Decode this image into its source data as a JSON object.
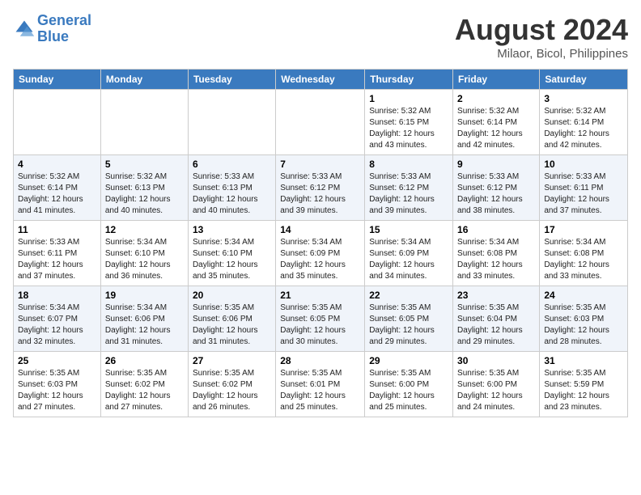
{
  "header": {
    "logo_line1": "General",
    "logo_line2": "Blue",
    "month_title": "August 2024",
    "subtitle": "Milaor, Bicol, Philippines"
  },
  "days_of_week": [
    "Sunday",
    "Monday",
    "Tuesday",
    "Wednesday",
    "Thursday",
    "Friday",
    "Saturday"
  ],
  "weeks": [
    [
      {
        "day": "",
        "info": ""
      },
      {
        "day": "",
        "info": ""
      },
      {
        "day": "",
        "info": ""
      },
      {
        "day": "",
        "info": ""
      },
      {
        "day": "1",
        "info": "Sunrise: 5:32 AM\nSunset: 6:15 PM\nDaylight: 12 hours and 43 minutes."
      },
      {
        "day": "2",
        "info": "Sunrise: 5:32 AM\nSunset: 6:14 PM\nDaylight: 12 hours and 42 minutes."
      },
      {
        "day": "3",
        "info": "Sunrise: 5:32 AM\nSunset: 6:14 PM\nDaylight: 12 hours and 42 minutes."
      }
    ],
    [
      {
        "day": "4",
        "info": "Sunrise: 5:32 AM\nSunset: 6:14 PM\nDaylight: 12 hours and 41 minutes."
      },
      {
        "day": "5",
        "info": "Sunrise: 5:32 AM\nSunset: 6:13 PM\nDaylight: 12 hours and 40 minutes."
      },
      {
        "day": "6",
        "info": "Sunrise: 5:33 AM\nSunset: 6:13 PM\nDaylight: 12 hours and 40 minutes."
      },
      {
        "day": "7",
        "info": "Sunrise: 5:33 AM\nSunset: 6:12 PM\nDaylight: 12 hours and 39 minutes."
      },
      {
        "day": "8",
        "info": "Sunrise: 5:33 AM\nSunset: 6:12 PM\nDaylight: 12 hours and 39 minutes."
      },
      {
        "day": "9",
        "info": "Sunrise: 5:33 AM\nSunset: 6:12 PM\nDaylight: 12 hours and 38 minutes."
      },
      {
        "day": "10",
        "info": "Sunrise: 5:33 AM\nSunset: 6:11 PM\nDaylight: 12 hours and 37 minutes."
      }
    ],
    [
      {
        "day": "11",
        "info": "Sunrise: 5:33 AM\nSunset: 6:11 PM\nDaylight: 12 hours and 37 minutes."
      },
      {
        "day": "12",
        "info": "Sunrise: 5:34 AM\nSunset: 6:10 PM\nDaylight: 12 hours and 36 minutes."
      },
      {
        "day": "13",
        "info": "Sunrise: 5:34 AM\nSunset: 6:10 PM\nDaylight: 12 hours and 35 minutes."
      },
      {
        "day": "14",
        "info": "Sunrise: 5:34 AM\nSunset: 6:09 PM\nDaylight: 12 hours and 35 minutes."
      },
      {
        "day": "15",
        "info": "Sunrise: 5:34 AM\nSunset: 6:09 PM\nDaylight: 12 hours and 34 minutes."
      },
      {
        "day": "16",
        "info": "Sunrise: 5:34 AM\nSunset: 6:08 PM\nDaylight: 12 hours and 33 minutes."
      },
      {
        "day": "17",
        "info": "Sunrise: 5:34 AM\nSunset: 6:08 PM\nDaylight: 12 hours and 33 minutes."
      }
    ],
    [
      {
        "day": "18",
        "info": "Sunrise: 5:34 AM\nSunset: 6:07 PM\nDaylight: 12 hours and 32 minutes."
      },
      {
        "day": "19",
        "info": "Sunrise: 5:34 AM\nSunset: 6:06 PM\nDaylight: 12 hours and 31 minutes."
      },
      {
        "day": "20",
        "info": "Sunrise: 5:35 AM\nSunset: 6:06 PM\nDaylight: 12 hours and 31 minutes."
      },
      {
        "day": "21",
        "info": "Sunrise: 5:35 AM\nSunset: 6:05 PM\nDaylight: 12 hours and 30 minutes."
      },
      {
        "day": "22",
        "info": "Sunrise: 5:35 AM\nSunset: 6:05 PM\nDaylight: 12 hours and 29 minutes."
      },
      {
        "day": "23",
        "info": "Sunrise: 5:35 AM\nSunset: 6:04 PM\nDaylight: 12 hours and 29 minutes."
      },
      {
        "day": "24",
        "info": "Sunrise: 5:35 AM\nSunset: 6:03 PM\nDaylight: 12 hours and 28 minutes."
      }
    ],
    [
      {
        "day": "25",
        "info": "Sunrise: 5:35 AM\nSunset: 6:03 PM\nDaylight: 12 hours and 27 minutes."
      },
      {
        "day": "26",
        "info": "Sunrise: 5:35 AM\nSunset: 6:02 PM\nDaylight: 12 hours and 27 minutes."
      },
      {
        "day": "27",
        "info": "Sunrise: 5:35 AM\nSunset: 6:02 PM\nDaylight: 12 hours and 26 minutes."
      },
      {
        "day": "28",
        "info": "Sunrise: 5:35 AM\nSunset: 6:01 PM\nDaylight: 12 hours and 25 minutes."
      },
      {
        "day": "29",
        "info": "Sunrise: 5:35 AM\nSunset: 6:00 PM\nDaylight: 12 hours and 25 minutes."
      },
      {
        "day": "30",
        "info": "Sunrise: 5:35 AM\nSunset: 6:00 PM\nDaylight: 12 hours and 24 minutes."
      },
      {
        "day": "31",
        "info": "Sunrise: 5:35 AM\nSunset: 5:59 PM\nDaylight: 12 hours and 23 minutes."
      }
    ]
  ]
}
